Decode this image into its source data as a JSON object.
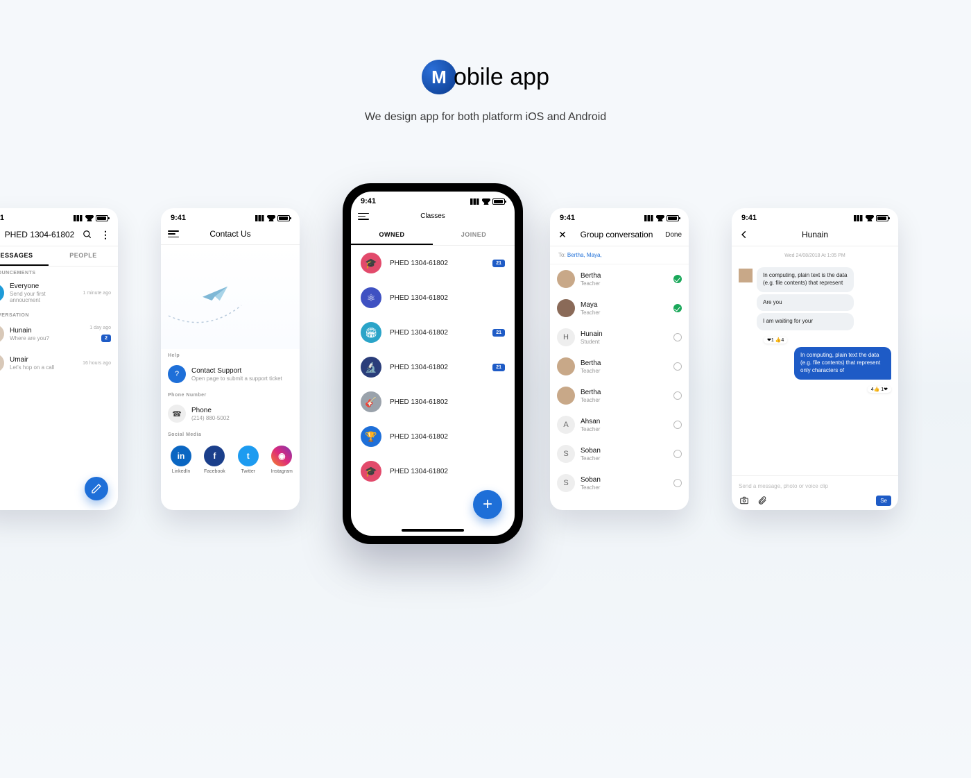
{
  "hero": {
    "logo_m": "M",
    "logo_rest": "obile app",
    "subtitle": "We design app for both platform iOS and Android"
  },
  "status_time": "9:41",
  "p1": {
    "title": "PHED 1304-61802",
    "tabs": [
      "MESSAGES",
      "PEOPLE"
    ],
    "sec1": "ANNOUNCEMENTS",
    "ann": {
      "name": "Everyone",
      "sub": "Send your first annoucment",
      "meta": "1 minute ago"
    },
    "sec2": "CONVERSATION",
    "conv": [
      {
        "name": "Hunain",
        "sub": "Where are you?",
        "meta": "1 day ago",
        "badge": "2"
      },
      {
        "name": "Umair",
        "sub": "Let's hop on a call",
        "meta": "16 hours ago"
      }
    ]
  },
  "p2": {
    "title": "Contact Us",
    "help_hdr": "Help",
    "support": {
      "title": "Contact Support",
      "sub": "Open page to submit a support ticket"
    },
    "phone_hdr": "Phone Number",
    "phone": {
      "title": "Phone",
      "sub": "(214) 880-5002"
    },
    "social_hdr": "Social Media",
    "socials": [
      {
        "label": "LinkedIn",
        "color": "#0a66c2",
        "glyph": "in"
      },
      {
        "label": "Facebook",
        "color": "#1b3f8b",
        "glyph": "f"
      },
      {
        "label": "Twitter",
        "color": "#1d9bf0",
        "glyph": "t"
      },
      {
        "label": "Instagram",
        "color": "linear-gradient(45deg,#f58529,#dd2a7b,#8134af)",
        "glyph": "ig"
      }
    ]
  },
  "p3": {
    "title": "Classes",
    "tabs": [
      "OWNED",
      "JOINED"
    ],
    "classes": [
      {
        "name": "PHED 1304-61802",
        "color": "#e24a6b",
        "icon": "cap",
        "badge": "21"
      },
      {
        "name": "PHED 1304-61802",
        "color": "#3f51c2",
        "icon": "atom"
      },
      {
        "name": "PHED 1304-61802",
        "color": "#2aa4c8",
        "icon": "field",
        "badge": "21"
      },
      {
        "name": "PHED 1304-61802",
        "color": "#2a3d7a",
        "icon": "scope",
        "badge": "21"
      },
      {
        "name": "PHED 1304-61802",
        "color": "#9aa2ab",
        "icon": "guitar"
      },
      {
        "name": "PHED 1304-61802",
        "color": "#1e6fd8",
        "icon": "trophy"
      },
      {
        "name": "PHED 1304-61802",
        "color": "#e24a6b",
        "icon": "cap"
      }
    ]
  },
  "p4": {
    "title": "Group conversation",
    "done": "Done",
    "to_label": "To:",
    "to_names": "Bertha,  Maya,",
    "people": [
      {
        "name": "Bertha",
        "role": "Teacher",
        "selected": true,
        "av": "photo1"
      },
      {
        "name": "Maya",
        "role": "Teacher",
        "selected": true,
        "av": "photo2"
      },
      {
        "name": "Hunain",
        "role": "Student",
        "av": "H"
      },
      {
        "name": "Bertha",
        "role": "Teacher",
        "av": "photo1"
      },
      {
        "name": "Bertha",
        "role": "Teacher",
        "av": "photo1"
      },
      {
        "name": "Ahsan",
        "role": "Teacher",
        "av": "A"
      },
      {
        "name": "Soban",
        "role": "Teacher",
        "av": "S"
      },
      {
        "name": "Soban",
        "role": "Teacher",
        "av": "S"
      }
    ]
  },
  "p5": {
    "title": "Hunain",
    "date": "Wed 24/08/2018 At 1:05 PM",
    "msgs": [
      {
        "dir": "in",
        "text": "In computing, plain text is the data (e.g. file contents) that represent"
      },
      {
        "dir": "in",
        "text": "Are you"
      },
      {
        "dir": "in",
        "text": "I am waiting for your",
        "react": "❤1 👍4"
      },
      {
        "dir": "out",
        "text": "In computing, plain text the data (e.g. file contents) that represent only characters of",
        "react": "4👍 1❤"
      }
    ],
    "composer_ph": "Send a message, photo or voice clip",
    "send": "Se"
  }
}
